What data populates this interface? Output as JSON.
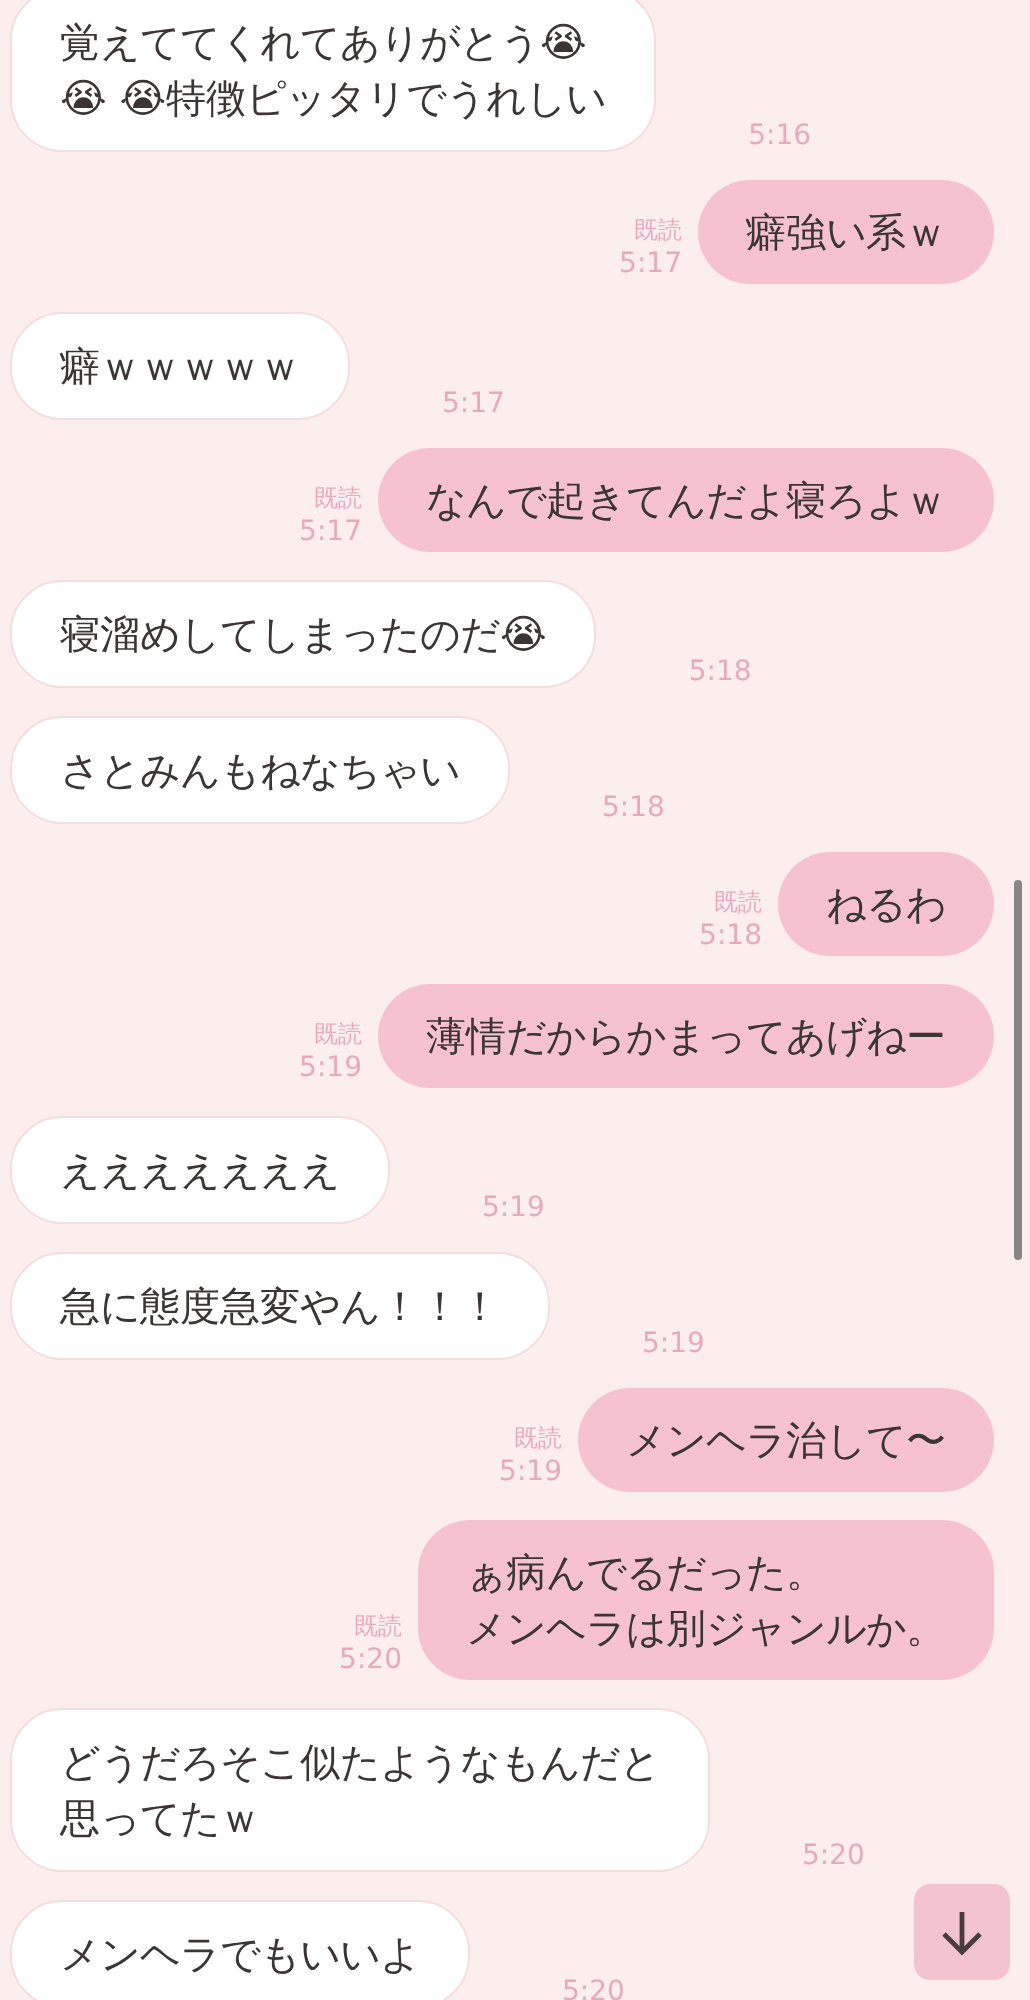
{
  "messages": [
    {
      "kind": "incoming",
      "lines": [
        "覚えててくれてありがとう😭",
        "😭 😭特徴ピッタリでうれしい"
      ],
      "time": "5:16"
    },
    {
      "kind": "outgoing",
      "lines": [
        "癖強い系ｗ"
      ],
      "time": "5:17",
      "read_label": "既読"
    },
    {
      "kind": "incoming",
      "lines": [
        "癖ｗｗｗｗｗ"
      ],
      "time": "5:17"
    },
    {
      "kind": "outgoing",
      "lines": [
        "なんで起きてんだよ寝ろよｗ"
      ],
      "time": "5:17",
      "read_label": "既読"
    },
    {
      "kind": "incoming",
      "lines": [
        "寝溜めしてしまったのだ😭"
      ],
      "time": "5:18"
    },
    {
      "kind": "incoming",
      "lines": [
        "さとみんもねなちゃい"
      ],
      "time": "5:18"
    },
    {
      "kind": "outgoing",
      "lines": [
        "ねるわ"
      ],
      "time": "5:18",
      "read_label": "既読"
    },
    {
      "kind": "outgoing",
      "lines": [
        "薄情だからかまってあげねー"
      ],
      "time": "5:19",
      "read_label": "既読"
    },
    {
      "kind": "incoming",
      "lines": [
        "えええええええ"
      ],
      "time": "5:19"
    },
    {
      "kind": "incoming",
      "lines": [
        "急に態度急変やん！！！"
      ],
      "time": "5:19"
    },
    {
      "kind": "outgoing",
      "lines": [
        "メンヘラ治して〜"
      ],
      "time": "5:19",
      "read_label": "既読"
    },
    {
      "kind": "outgoing",
      "lines": [
        "ぁ病んでるだった。",
        "メンヘラは別ジャンルか。"
      ],
      "time": "5:20",
      "read_label": "既読"
    },
    {
      "kind": "incoming",
      "lines": [
        "どうだろそこ似たようなもんだと",
        "思ってたｗ"
      ],
      "time": "5:20"
    },
    {
      "kind": "incoming",
      "lines": [
        "メンヘラでもいいよ"
      ],
      "time": "5:20"
    }
  ]
}
